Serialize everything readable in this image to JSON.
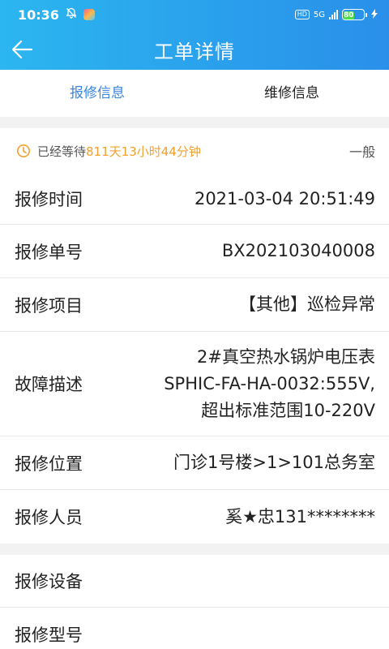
{
  "status_bar": {
    "time": "10:36",
    "network": "5G",
    "battery": "80"
  },
  "header": {
    "title": "工单详情"
  },
  "tabs": [
    {
      "label": "报修信息",
      "active": true
    },
    {
      "label": "维修信息",
      "active": false
    }
  ],
  "wait": {
    "prefix": "已经等待",
    "duration": "811天13小时44分钟",
    "level": "一般"
  },
  "details": [
    {
      "label": "报修时间",
      "value": "2021-03-04 20:51:49"
    },
    {
      "label": "报修单号",
      "value": "BX202103040008"
    },
    {
      "label": "报修项目",
      "value": "【其他】巡检异常"
    },
    {
      "label": "故障描述",
      "value_lines": [
        "2#真空热水锅炉电压表",
        "SPHIC-FA-HA-0032:555V,",
        "超出标准范围10-220V"
      ]
    },
    {
      "label": "报修位置",
      "value": "门诊1号楼>1>101总务室"
    },
    {
      "label": "报修人员",
      "value": "奚★忠131********"
    }
  ],
  "device": [
    {
      "label": "报修设备",
      "value": ""
    },
    {
      "label": "报修型号",
      "value": ""
    }
  ],
  "colors": {
    "header_start": "#2bb6f0",
    "header_end": "#2a8fe9",
    "tab_active": "#3a86e0",
    "wait_highlight": "#f3a02c"
  }
}
